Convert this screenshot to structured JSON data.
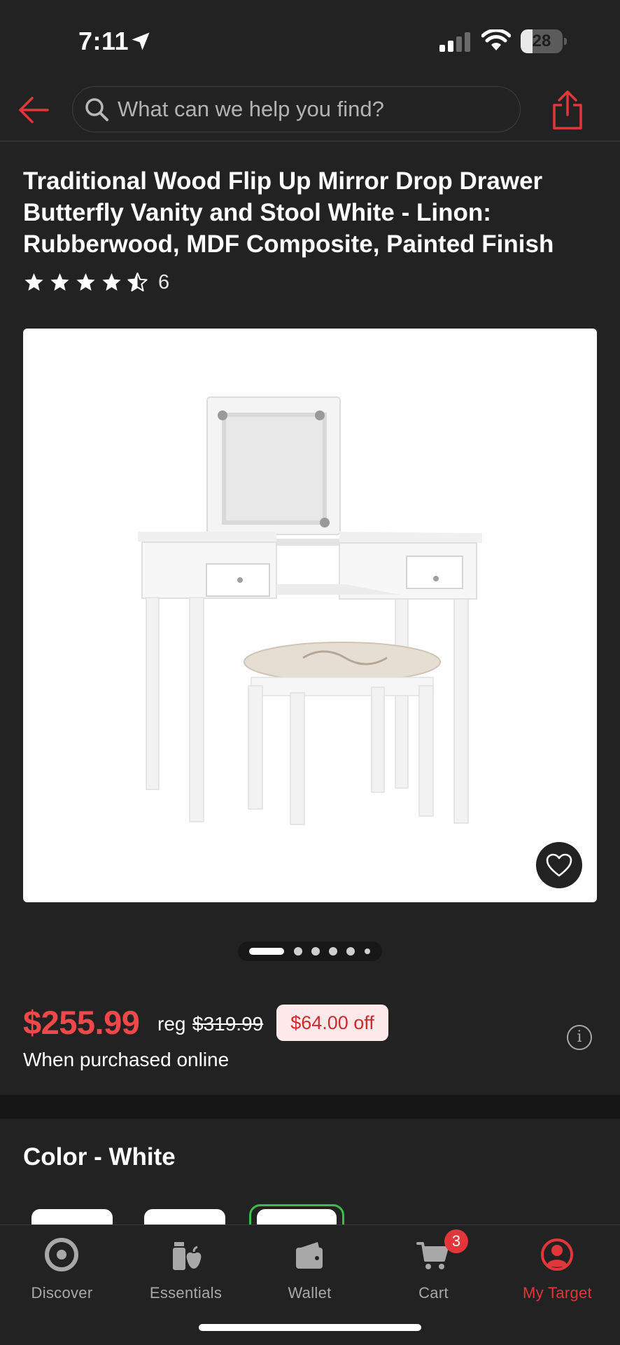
{
  "status_bar": {
    "time": "7:11",
    "battery": "28",
    "battery_level": 0.28
  },
  "search": {
    "placeholder": "What can we help you find?"
  },
  "product": {
    "title": "Traditional Wood Flip Up Mirror Drop Drawer Butterfly Vanity and Stool White - Linon: Rubberwood, MDF Composite, Painted Finish",
    "rating": 4.5,
    "review_count": "6",
    "image_pages": 6,
    "image_page_active": 1
  },
  "pricing": {
    "price": "$255.99",
    "reg_label": "reg",
    "reg_price": "$319.99",
    "discount": "$64.00 off",
    "note": "When purchased online",
    "info_icon": "i"
  },
  "variant": {
    "label": "Color - White",
    "swatch_count": 3,
    "selected_index": 2
  },
  "tabs": [
    {
      "label": "Discover",
      "icon": "target-icon"
    },
    {
      "label": "Essentials",
      "icon": "essentials-icon"
    },
    {
      "label": "Wallet",
      "icon": "wallet-icon"
    },
    {
      "label": "Cart",
      "icon": "cart-icon",
      "badge": "3"
    },
    {
      "label": "My Target",
      "icon": "account-icon",
      "active": true
    }
  ],
  "colors": {
    "accent": "#e2363b",
    "price": "#f0484a",
    "selected_swatch": "#3bbf4b",
    "background": "#222222"
  }
}
